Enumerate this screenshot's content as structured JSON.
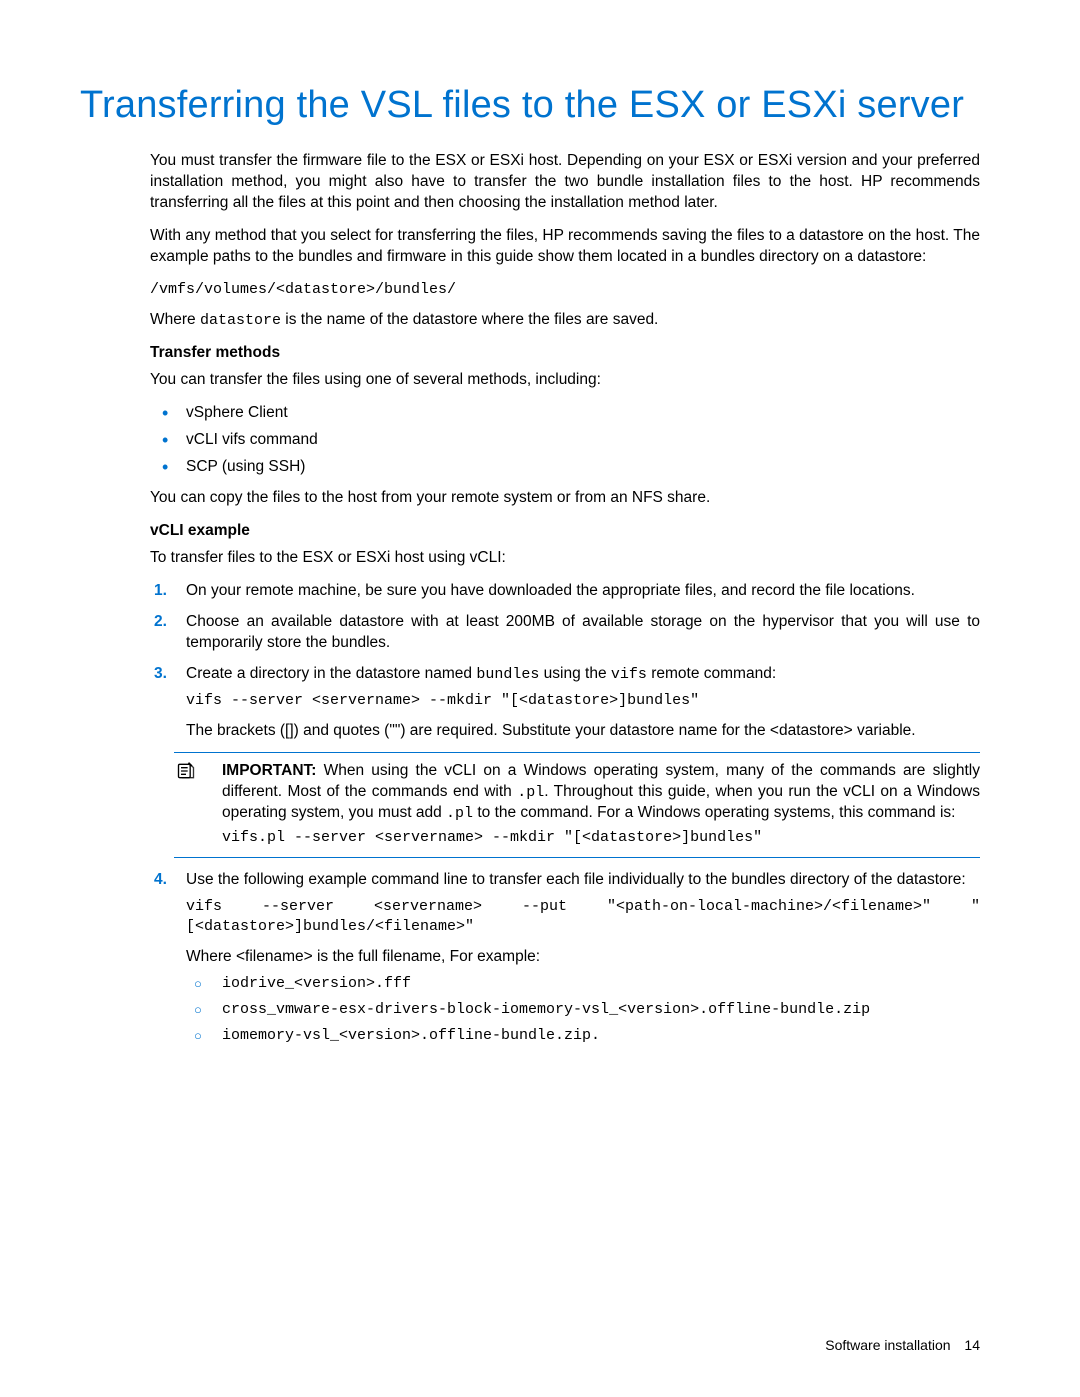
{
  "title": "Transferring the VSL files to the ESX or ESXi server",
  "para1": "You must transfer the firmware file to the ESX or ESXi host. Depending on your ESX or ESXi version and your preferred installation method, you might also have to transfer the two bundle installation files to the host. HP recommends transferring all the files at this point and then choosing the installation method later.",
  "para2": "With any method that you select for transferring the files, HP recommends saving the files to a datastore on the host. The example paths to the bundles and firmware in this guide show them located in a bundles directory on a datastore:",
  "path": "/vmfs/volumes/<datastore>/bundles/",
  "para3_pre": "Where ",
  "para3_code": "datastore",
  "para3_post": " is the name of the datastore where the files are saved.",
  "subhead1": "Transfer methods",
  "para4": "You can transfer the files using one of several methods, including:",
  "bullets": {
    "b1": "vSphere Client",
    "b2": "vCLI vifs command",
    "b3": "SCP (using SSH)"
  },
  "para5": "You can copy the files to the host from your remote system or from an NFS share.",
  "subhead2": "vCLI example",
  "para6": "To transfer files to the ESX or ESXi host using vCLI:",
  "steps": {
    "s1": "On your remote machine, be sure you have downloaded the appropriate files, and record the file locations.",
    "s2": "Choose an available datastore with at least 200MB of available storage on the hypervisor that you will use to temporarily store the bundles.",
    "s3_pre": "Create a directory in the datastore named ",
    "s3_code1": "bundles",
    "s3_mid": " using the ",
    "s3_code2": "vifs",
    "s3_post": " remote command:",
    "s3_cmd": "vifs --server <servername> --mkdir \"[<datastore>]bundles\"",
    "s3_after": "The brackets ([]) and quotes (\"\") are required. Substitute your datastore name for the <datastore> variable.",
    "important_label": "IMPORTANT:",
    "important_pre": "   When using the vCLI on a Windows operating system, many of the commands are slightly different. Most of the commands end with ",
    "important_code1": ".pl",
    "important_mid": ". Throughout this guide, when you run the vCLI on a Windows operating system, you must add ",
    "important_code2": ".pl",
    "important_post": " to the command. For a Windows operating systems, this command is:",
    "important_cmd": "vifs.pl --server <servername> --mkdir \"[<datastore>]bundles\"",
    "s4_pre": "Use the following example command line to transfer each file individually to the bundles directory of the datastore:",
    "s4_cmd": "vifs --server <servername> --put \"<path-on-local-machine>/<filename>\" \"[<datastore>]bundles/<filename>\"",
    "s4_after": "Where <filename> is the full filename, For example:",
    "files": {
      "f1": "iodrive_<version>.fff",
      "f2": "cross_vmware-esx-drivers-block-iomemory-vsl_<version>.offline-bundle.zip",
      "f3": "iomemory-vsl_<version>.offline-bundle.zip."
    }
  },
  "footer_text": "Software installation",
  "page_num": "14"
}
